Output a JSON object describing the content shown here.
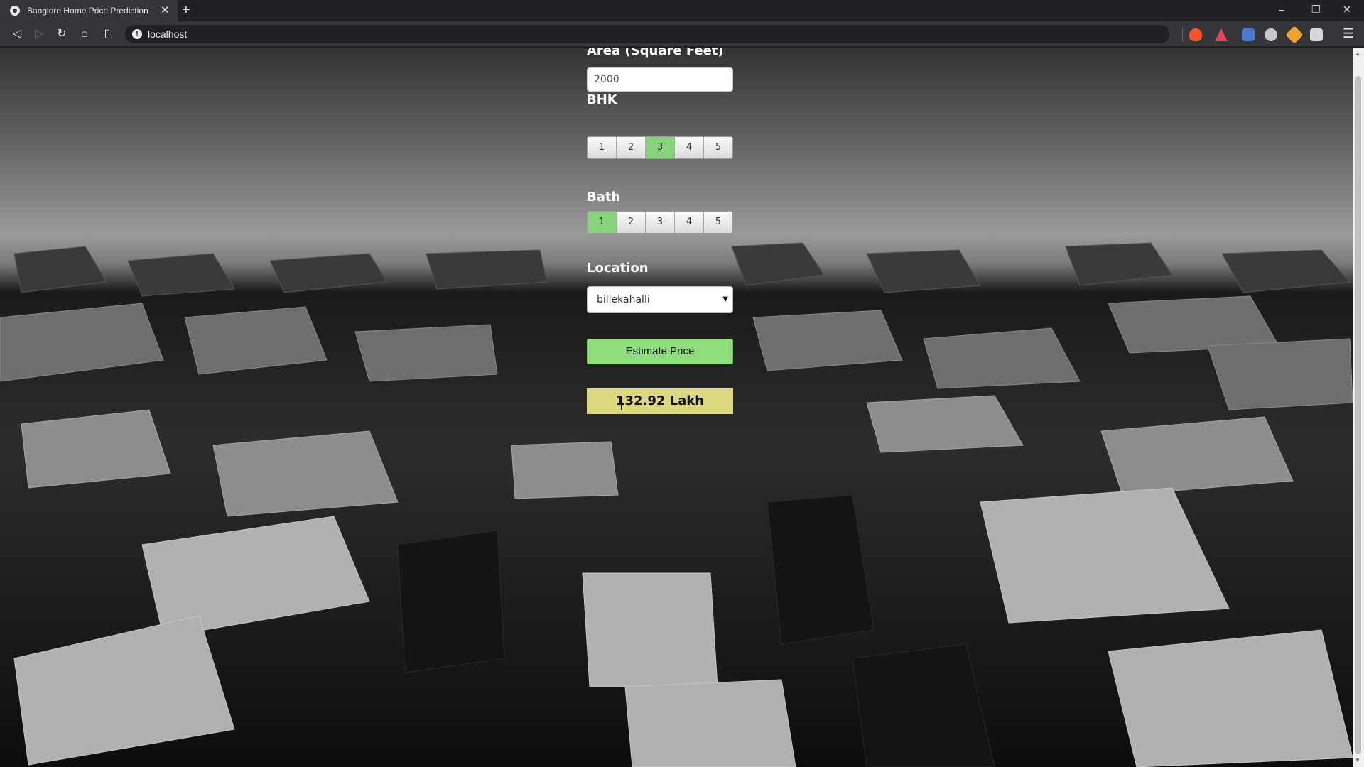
{
  "browser": {
    "tab_title": "Banglore Home Price Prediction",
    "url": "localhost"
  },
  "icons": {
    "tab": [
      "favicon-icon",
      "close-icon",
      "new-tab-icon"
    ],
    "window": [
      "minimize-icon",
      "restore-icon",
      "window-close-icon"
    ],
    "nav": [
      "back-icon",
      "forward-icon",
      "reload-icon",
      "home-icon",
      "bookmark-icon",
      "info-icon"
    ],
    "extensions": [
      "brave-shields-icon",
      "brave-rewards-icon",
      "translate-icon",
      "cloud-icon",
      "tag-icon",
      "media-icon",
      "menu-icon"
    ]
  },
  "form": {
    "area_label": "Area (Square Feet)",
    "area_value": "2000",
    "bhk_label": "BHK",
    "bhk_options": [
      "1",
      "2",
      "3",
      "4",
      "5"
    ],
    "bhk_selected": "3",
    "bath_label": "Bath",
    "bath_options": [
      "1",
      "2",
      "3",
      "4",
      "5"
    ],
    "bath_selected": "1",
    "location_label": "Location",
    "location_value": "billekahalli",
    "estimate_button": "Estimate Price",
    "result": "132.92 Lakh"
  },
  "colors": {
    "selected_option": "#87d37c",
    "button": "#8fde7e",
    "result_box": "#dcd87f"
  }
}
